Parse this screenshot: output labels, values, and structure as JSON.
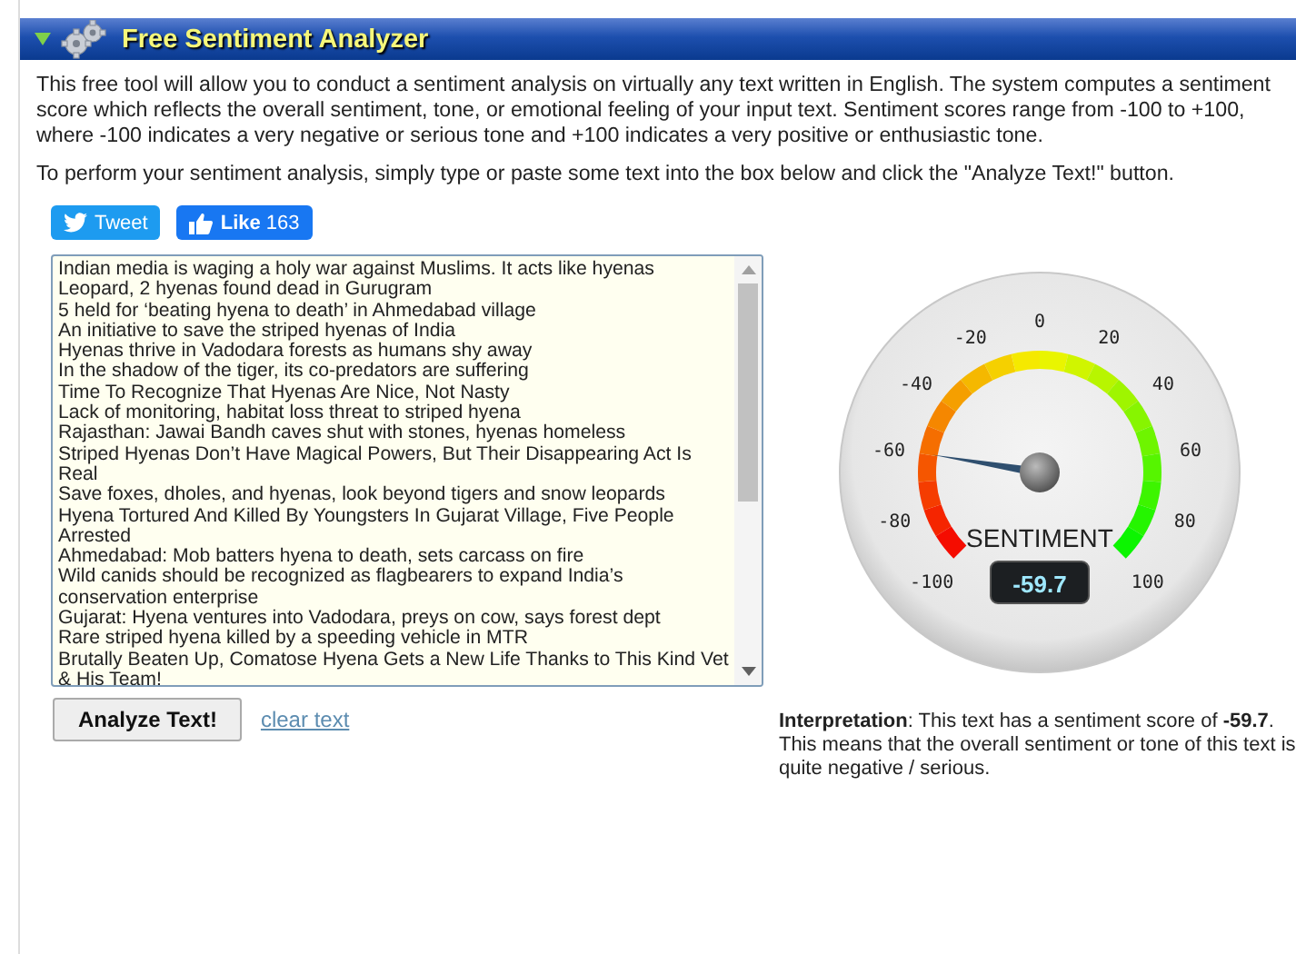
{
  "header": {
    "title": "Free Sentiment Analyzer",
    "expanded": true
  },
  "intro": [
    "This free tool will allow you to conduct a sentiment analysis on virtually any text written in English. The system computes a sentiment score which reflects the overall sentiment, tone, or emotional feeling of your input text. Sentiment scores range from -100 to +100, where -100 indicates a very negative or serious tone and +100 indicates a very positive or enthusiastic tone.",
    "To perform your sentiment analysis, simply type or paste some text into the box below and click the \"Analyze Text!\" button."
  ],
  "share_buttons": [
    {
      "kind": "tweet",
      "label": "Tweet"
    },
    {
      "kind": "like",
      "label": "**Like** 163"
    }
  ],
  "input_text": {
    "lines": [
      "Indian media is waging a holy war against Muslims. It acts like hyenas",
      "Leopard, 2 hyenas found dead in Gurugram",
      "5 held for ‘beating hyena to death’ in Ahmedabad village",
      "An initiative to save the striped hyenas of India",
      "Hyenas thrive in Vadodara forests as humans shy away",
      "In the shadow of the tiger, its co-predators are suffering",
      "Time To Recognize That Hyenas Are Nice, Not Nasty",
      "Lack of monitoring, habitat loss threat to striped hyena",
      "Rajasthan: Jawai Bandh caves shut with stones, hyenas homeless",
      "Striped Hyenas Don’t Have Magical Powers, But Their Disappearing Act Is Real",
      "Save foxes, dholes, and hyenas, look beyond tigers and snow leopards",
      "Hyena Tortured And Killed By Youngsters In Gujarat Village, Five People Arrested",
      "Ahmedabad: Mob batters hyena to death, sets carcass on fire",
      "Wild canids should be recognized as flagbearers to expand India’s conservation enterprise",
      "Gujarat: Hyena ventures into Vadodara, preys on cow, says forest dept",
      "Rare striped hyena killed by a speeding vehicle in MTR",
      "Brutally Beaten Up, Comatose Hyena Gets a New Life Thanks to This Kind Vet & His Team!"
    ]
  },
  "analyze_button": "Analyze Text!",
  "clear_link": "clear text",
  "gauge": {
    "ticks": [
      "-100",
      "-80",
      "-60",
      "-40",
      "-20",
      "0",
      "20",
      "40",
      "60",
      "80",
      "100"
    ],
    "title": "SENTIMENT",
    "reading": "-59.7"
  },
  "interpretation": "**Interpretation**: This text has a sentiment score of **-59.7**. This means that the overall sentiment or tone of this text is quite negative / serious."
}
